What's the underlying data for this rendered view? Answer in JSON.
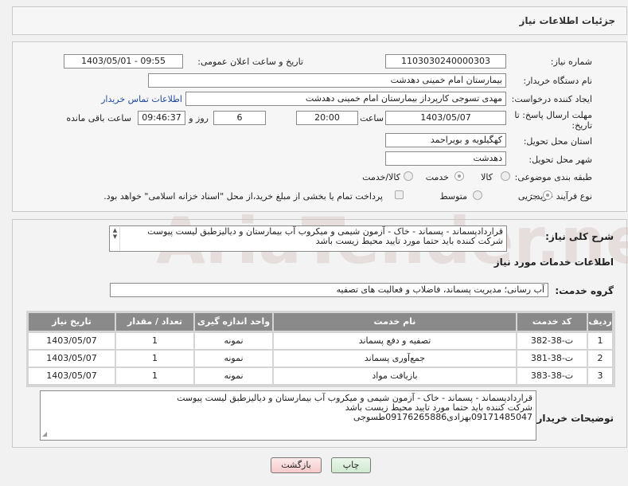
{
  "header": {
    "title": "جزئیات اطلاعات نیاز"
  },
  "form": {
    "need_number_label": "شماره نیاز:",
    "need_number": "1103030240000303",
    "announce_label": "تاریخ و ساعت اعلان عمومی:",
    "announce_value": "1403/05/01 - 09:55",
    "buyer_org_label": "نام دستگاه خریدار:",
    "buyer_org": "بیمارستان امام خمینی دهدشت",
    "creator_label": "ایجاد کننده درخواست:",
    "creator": "مهدی تسوجی کارپرداز بیمارستان امام خمینی دهدشت",
    "contact_link": "اطلاعات تماس خریدار",
    "deadline_label_1": "مهلت ارسال پاسخ: تا",
    "deadline_label_2": "تاریخ:",
    "deadline_date": "1403/05/07",
    "time_label": "ساعت",
    "deadline_time": "20:00",
    "days": "6",
    "days_label": "روز و",
    "remaining_time": "09:46:37",
    "remaining_label": "ساعت باقی مانده",
    "province_label": "استان محل تحویل:",
    "province": "کهگیلویه و بویراحمد",
    "city_label": "شهر محل تحویل:",
    "city": "دهدشت",
    "category_label": "طبقه بندی موضوعی:",
    "category_options": [
      "کالا",
      "خدمت",
      "کالا/خدمت"
    ],
    "process_label": "نوع فرآیند خرید :",
    "process_options": [
      "جزیی",
      "متوسط"
    ],
    "payment_note": "پرداخت تمام یا بخشی از مبلغ خرید،از محل \"اسناد خزانه اسلامی\" خواهد بود."
  },
  "summary": {
    "label": "شرح کلی نیاز:",
    "text": "قراردادپسماند - پسماند - خاک - آزمون شیمی و میکروب آب بیمارستان و دیالیزطبق لیست پیوست شرکت کننده باید حتما مورد تایید محیط زیست باشد"
  },
  "services": {
    "title": "اطلاعات خدمات مورد نیاز",
    "group_label": "گروه خدمت:",
    "group_value": "آب رسانی؛ مدیریت پسماند، فاضلاب و فعالیت های تصفیه",
    "columns": [
      "ردیف",
      "کد خدمت",
      "نام خدمت",
      "واحد اندازه گیری",
      "تعداد / مقدار",
      "تاریخ نیاز"
    ],
    "rows": [
      [
        "1",
        "ت-38-382",
        "تصفیه و دفع پسماند",
        "نمونه",
        "1",
        "1403/05/07"
      ],
      [
        "2",
        "ت-38-381",
        "جمع‌آوری پسماند",
        "نمونه",
        "1",
        "1403/05/07"
      ],
      [
        "3",
        "ت-38-383",
        "بازیافت مواد",
        "نمونه",
        "1",
        "1403/05/07"
      ]
    ]
  },
  "buyer_notes": {
    "label": "توضیحات خریدار:",
    "lines": [
      "قراردادپسماند - پسماند - خاک - آزمون شیمی و میکروب آب بیمارستان و دیالیزطبق لیست پیوست",
      "شرکت کننده باید حتما مورد تایید محیط زیست باشد",
      "09171485047بهزادی09176265886طسوجی"
    ]
  },
  "buttons": {
    "print": "چاپ",
    "back": "بازگشت"
  },
  "watermark": "AriaTender.net"
}
